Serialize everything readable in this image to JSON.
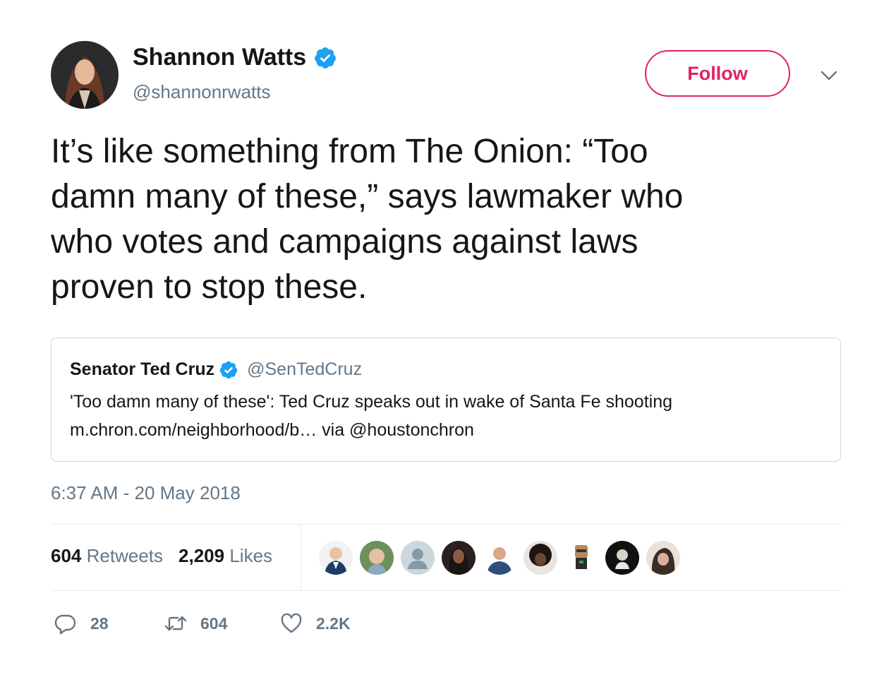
{
  "author": {
    "name": "Shannon Watts",
    "handle": "@shannonrwatts",
    "verified": true
  },
  "follow_label": "Follow",
  "tweet_lines": [
    "It’s like something from The Onion: “Too",
    "damn many of these,” says lawmaker who",
    "who votes and campaigns against laws",
    "proven to stop these."
  ],
  "quote": {
    "name": "Senator Ted Cruz",
    "handle": "@SenTedCruz",
    "verified": true,
    "line1": "'Too damn many of these': Ted Cruz speaks out in wake of Santa Fe shooting",
    "line2": "m.chron.com/neighborhood/b… via @houstonchron"
  },
  "timestamp": "6:37 AM - 20 May 2018",
  "stats": {
    "retweets_count": "604",
    "retweets_label": "Retweets",
    "likes_count": "2,209",
    "likes_label": "Likes"
  },
  "actions": {
    "reply_count": "28",
    "retweet_count": "604",
    "like_count": "2.2K"
  },
  "colors": {
    "accent": "#e0245e",
    "verified": "#1da1f2",
    "secondary_text": "#657786",
    "border": "#e6ecf0"
  }
}
